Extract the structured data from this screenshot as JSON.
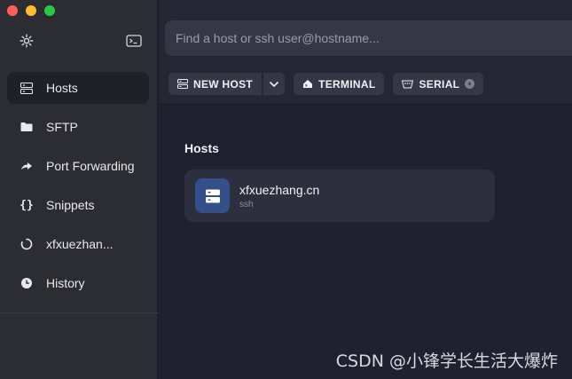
{
  "sidebar": {
    "items": [
      {
        "label": "Hosts",
        "icon": "server-rack-icon"
      },
      {
        "label": "SFTP",
        "icon": "folder-icon"
      },
      {
        "label": "Port Forwarding",
        "icon": "forward-arrow-icon"
      },
      {
        "label": "Snippets",
        "icon": "braces-icon"
      },
      {
        "label": "xfxuezhan...",
        "icon": "loading-spinner-icon"
      },
      {
        "label": "History",
        "icon": "clock-icon"
      }
    ],
    "active_index": 0
  },
  "search": {
    "placeholder": "Find a host or ssh user@hostname..."
  },
  "toolbar": {
    "new_host_label": "NEW HOST",
    "terminal_label": "TERMINAL",
    "serial_label": "SERIAL"
  },
  "hosts_section": {
    "title": "Hosts",
    "items": [
      {
        "name": "xfxuezhang.cn",
        "protocol": "ssh"
      }
    ]
  },
  "watermark": "CSDN @小锋学长生活大爆炸",
  "colors": {
    "sidebar_bg": "#2c2d33",
    "main_bg": "#1f2130",
    "host_icon_bg": "#34508a"
  }
}
